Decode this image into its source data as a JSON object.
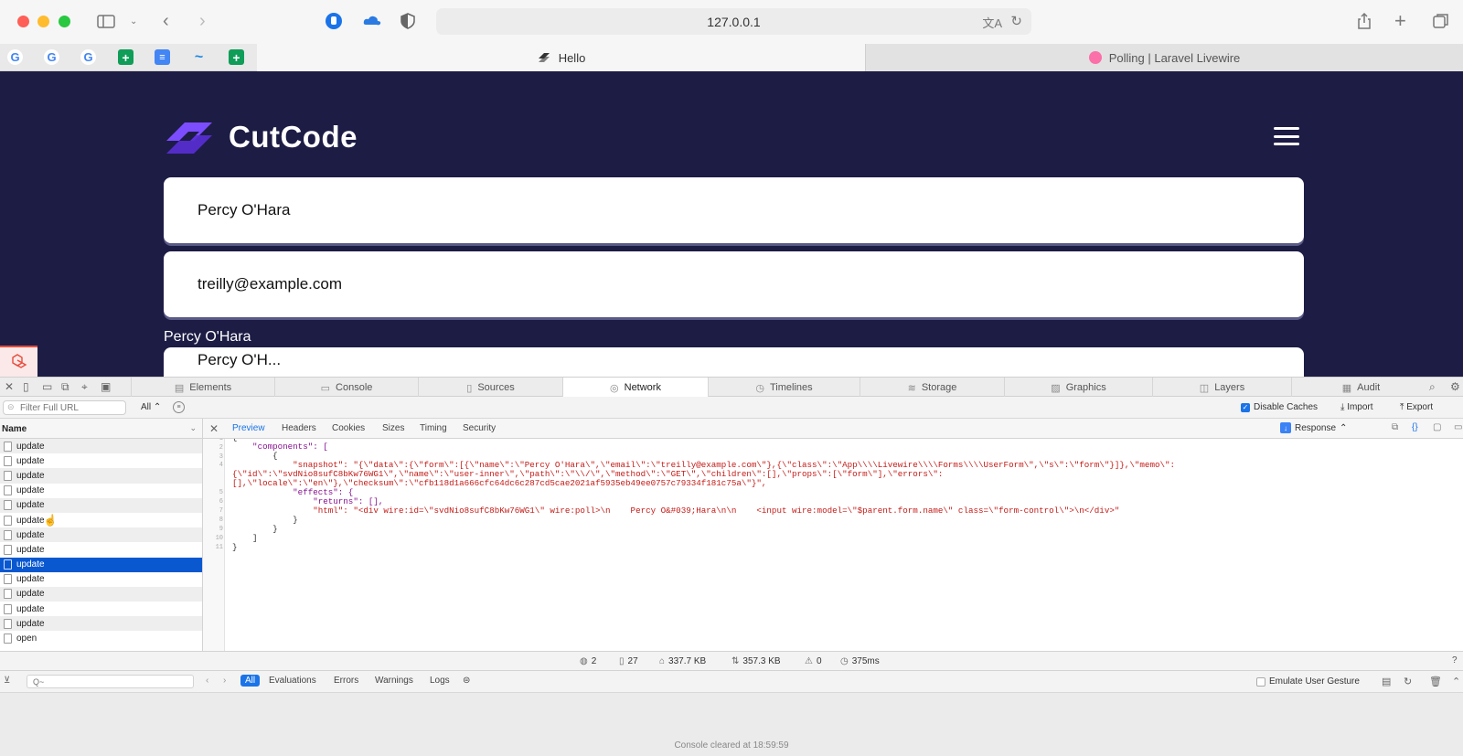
{
  "browser": {
    "url": "127.0.0.1",
    "tabs": [
      {
        "label": "Hello",
        "active": true
      },
      {
        "label": "Polling | Laravel Livewire",
        "active": false
      }
    ],
    "favorites": [
      "G",
      "G",
      "G",
      "+",
      "≡",
      "~",
      "+"
    ]
  },
  "page": {
    "logo_text": "CutCode",
    "name_input_value": "Percy O'Hara",
    "email_input_value": "treilly@example.com",
    "name_text": "Percy O'Hara",
    "third_input_partial": "Percy O'H..."
  },
  "devtools": {
    "tabs": [
      {
        "label": "Elements",
        "icon": "elements-icon"
      },
      {
        "label": "Console",
        "icon": "console-icon"
      },
      {
        "label": "Sources",
        "icon": "sources-icon"
      },
      {
        "label": "Network",
        "icon": "network-icon",
        "active": true
      },
      {
        "label": "Timelines",
        "icon": "timelines-icon"
      },
      {
        "label": "Storage",
        "icon": "storage-icon"
      },
      {
        "label": "Graphics",
        "icon": "graphics-icon"
      },
      {
        "label": "Layers",
        "icon": "layers-icon"
      },
      {
        "label": "Audit",
        "icon": "audit-icon"
      }
    ],
    "filter_placeholder": "Filter Full URL",
    "filter_type": "All",
    "disable_caches_label": "Disable Caches",
    "disable_caches_checked": true,
    "import_label": "Import",
    "export_label": "Export",
    "name_column": "Name",
    "requests": [
      {
        "name": "update"
      },
      {
        "name": "update"
      },
      {
        "name": "update"
      },
      {
        "name": "update"
      },
      {
        "name": "update"
      },
      {
        "name": "update"
      },
      {
        "name": "update"
      },
      {
        "name": "update"
      },
      {
        "name": "update",
        "selected": true
      },
      {
        "name": "update"
      },
      {
        "name": "update"
      },
      {
        "name": "update"
      },
      {
        "name": "update"
      },
      {
        "name": "open"
      }
    ],
    "detail_tabs": [
      "Preview",
      "Headers",
      "Cookies",
      "Sizes",
      "Timing",
      "Security"
    ],
    "response_label": "Response",
    "code_lines": [
      "{",
      "    \"components\": [",
      "        {",
      "            \"snapshot\": \"{\\\"data\\\":{\\\"form\\\":[{\\\"name\\\":\\\"Percy O'Hara\\\",\\\"email\\\":\\\"treilly@example.com\\\"},{\\\"class\\\":\\\"App\\\\\\\\Livewire\\\\\\\\Forms\\\\\\\\UserForm\\\",\\\"s\\\":\\\"form\\\"}]},\\\"memo\\\":",
      "{\\\"id\\\":\\\"svdNio8sufC8bKw76WG1\\\",\\\"name\\\":\\\"user-inner\\\",\\\"path\\\":\\\"\\\\/\\\",\\\"method\\\":\\\"GET\\\",\\\"children\\\":[],\\\"props\\\":[\\\"form\\\"],\\\"errors\\\":",
      "[],\\\"locale\\\":\\\"en\\\"},\\\"checksum\\\":\\\"cfb118d1a666cfc64dc6c287cd5cae2021af5935eb49ee0757c79334f181c75a\\\"}\",",
      "            \"effects\": {",
      "                \"returns\": [],",
      "                \"html\": \"<div wire:id=\\\"svdNio8sufC8bKw76WG1\\\" wire:poll>\\n    Percy O&#039;Hara\\n\\n    <input wire:model=\\\"$parent.form.name\\\" class=\\\"form-control\\\">\\n</div>\"",
      "            }",
      "        }",
      "    ]",
      "}"
    ],
    "line_numbers": [
      "1",
      "2",
      "3",
      "4",
      "",
      "",
      "5",
      "6",
      "7",
      "8",
      "9",
      "10",
      "11"
    ],
    "stats": [
      {
        "icon": "globe-icon",
        "value": "2"
      },
      {
        "icon": "document-icon",
        "value": "27"
      },
      {
        "icon": "weight-icon",
        "value": "337.7 KB"
      },
      {
        "icon": "transfer-icon",
        "value": "357.3 KB"
      },
      {
        "icon": "error-icon",
        "value": "0"
      },
      {
        "icon": "clock-icon",
        "value": "375ms"
      }
    ],
    "console_filters": [
      "All",
      "Evaluations",
      "Errors",
      "Warnings",
      "Logs"
    ],
    "emulate_label": "Emulate User Gesture",
    "console_cleared": "Console cleared at 18:59:59"
  }
}
